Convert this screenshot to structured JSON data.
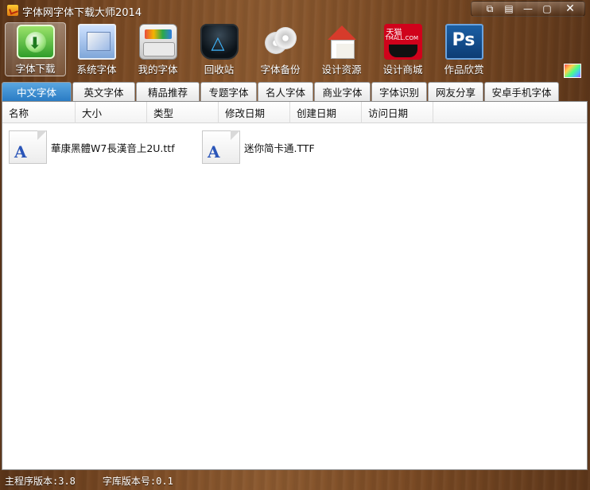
{
  "window": {
    "title": "字体网字体下载大师2014",
    "controls": [
      "chat-icon",
      "menu-icon",
      "minimize-icon",
      "maximize-icon",
      "close-icon"
    ],
    "control_glyphs": [
      "⧉",
      "▤",
      "—",
      "▢",
      "✕"
    ]
  },
  "toolbar": {
    "items": [
      {
        "label": "字体下载",
        "icon": "font-download-icon",
        "active": true
      },
      {
        "label": "系统字体",
        "icon": "system-fonts-icon"
      },
      {
        "label": "我的字体",
        "icon": "my-fonts-icon"
      },
      {
        "label": "回收站",
        "icon": "recycle-bin-icon"
      },
      {
        "label": "字体备份",
        "icon": "font-backup-icon"
      },
      {
        "label": "设计资源",
        "icon": "design-resources-icon"
      },
      {
        "label": "设计商城",
        "icon": "tmall-store-icon"
      },
      {
        "label": "作品欣赏",
        "icon": "photoshop-icon"
      }
    ],
    "skin_icon": "skin-palette-icon"
  },
  "tabs": [
    {
      "label": "中文字体",
      "active": true
    },
    {
      "label": "英文字体"
    },
    {
      "label": "精品推荐"
    },
    {
      "label": "专题字体"
    },
    {
      "label": "名人字体"
    },
    {
      "label": "商业字体"
    },
    {
      "label": "字体识别"
    },
    {
      "label": "网友分享"
    },
    {
      "label": "安卓手机字体"
    }
  ],
  "columns": [
    "名称",
    "大小",
    "类型",
    "修改日期",
    "创建日期",
    "访问日期"
  ],
  "files": [
    {
      "name": "華康黑體W7長漢音上2U.ttf",
      "icon": "font-file-icon",
      "glyph": "A"
    },
    {
      "name": "迷你简卡通.TTF",
      "icon": "font-file-icon",
      "glyph": "A"
    }
  ],
  "status": {
    "program_version": "主程序版本:3.8",
    "library_version": "字库版本号:0.1"
  }
}
